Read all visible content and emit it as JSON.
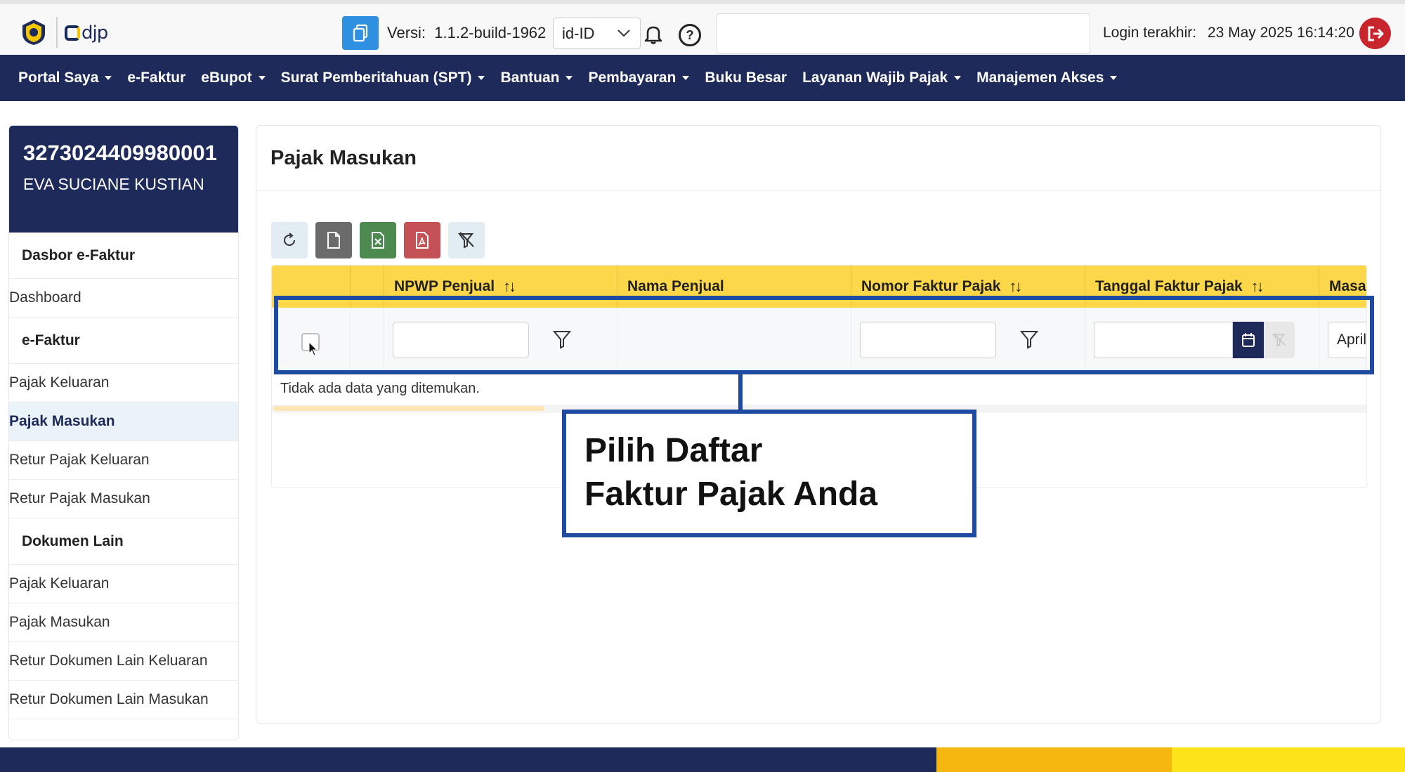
{
  "topbar": {
    "brand": "djp",
    "version_label": "Versi:",
    "version_value": "1.1.2-build-1962",
    "language": "id-ID",
    "last_login_label": "Login terakhir:",
    "last_login_value": "23 May 2025 16:14:20"
  },
  "nav": {
    "items": [
      {
        "label": "Portal Saya",
        "dropdown": true
      },
      {
        "label": "e-Faktur",
        "dropdown": false
      },
      {
        "label": "eBupot",
        "dropdown": true
      },
      {
        "label": "Surat Pemberitahuan (SPT)",
        "dropdown": true
      },
      {
        "label": "Bantuan",
        "dropdown": true
      },
      {
        "label": "Pembayaran",
        "dropdown": true
      },
      {
        "label": "Buku Besar",
        "dropdown": false
      },
      {
        "label": "Layanan Wajib Pajak",
        "dropdown": true
      },
      {
        "label": "Manajemen Akses",
        "dropdown": true
      }
    ]
  },
  "sidebar": {
    "npwp": "3273024409980001",
    "name": "EVA SUCIANE KUSTIAN",
    "sections": [
      {
        "title": "Dasbor e-Faktur",
        "links": [
          "Dashboard"
        ]
      },
      {
        "title": "e-Faktur",
        "links": [
          "Pajak Keluaran",
          "Pajak Masukan",
          "Retur Pajak Keluaran",
          "Retur Pajak Masukan"
        ]
      },
      {
        "title": "Dokumen Lain",
        "links": [
          "Pajak Keluaran",
          "Pajak Masukan",
          "Retur Dokumen Lain Keluaran",
          "Retur Dokumen Lain Masukan"
        ]
      }
    ],
    "active_link": "Pajak Masukan"
  },
  "main": {
    "title": "Pajak Masukan",
    "columns": [
      {
        "label": "",
        "sortable": false
      },
      {
        "label": "",
        "sortable": false
      },
      {
        "label": "NPWP Penjual",
        "sortable": true
      },
      {
        "label": "Nama Penjual",
        "sortable": false
      },
      {
        "label": "Nomor Faktur Pajak",
        "sortable": true
      },
      {
        "label": "Tanggal Faktur Pajak",
        "sortable": true
      },
      {
        "label": "Masa",
        "sortable": false
      }
    ],
    "masa_filter_value": "April",
    "empty_message": "Tidak ada data yang ditemukan.",
    "sort_glyph": "↑↓"
  },
  "annotation": {
    "line1": "Pilih Daftar",
    "line2": "Faktur Pajak Anda",
    "color": "#1f4aa2"
  },
  "colors": {
    "navy": "#1e2a5a",
    "header_yellow": "#fdd74a",
    "logout_red": "#c8252c",
    "copy_blue": "#2f8fe0"
  }
}
